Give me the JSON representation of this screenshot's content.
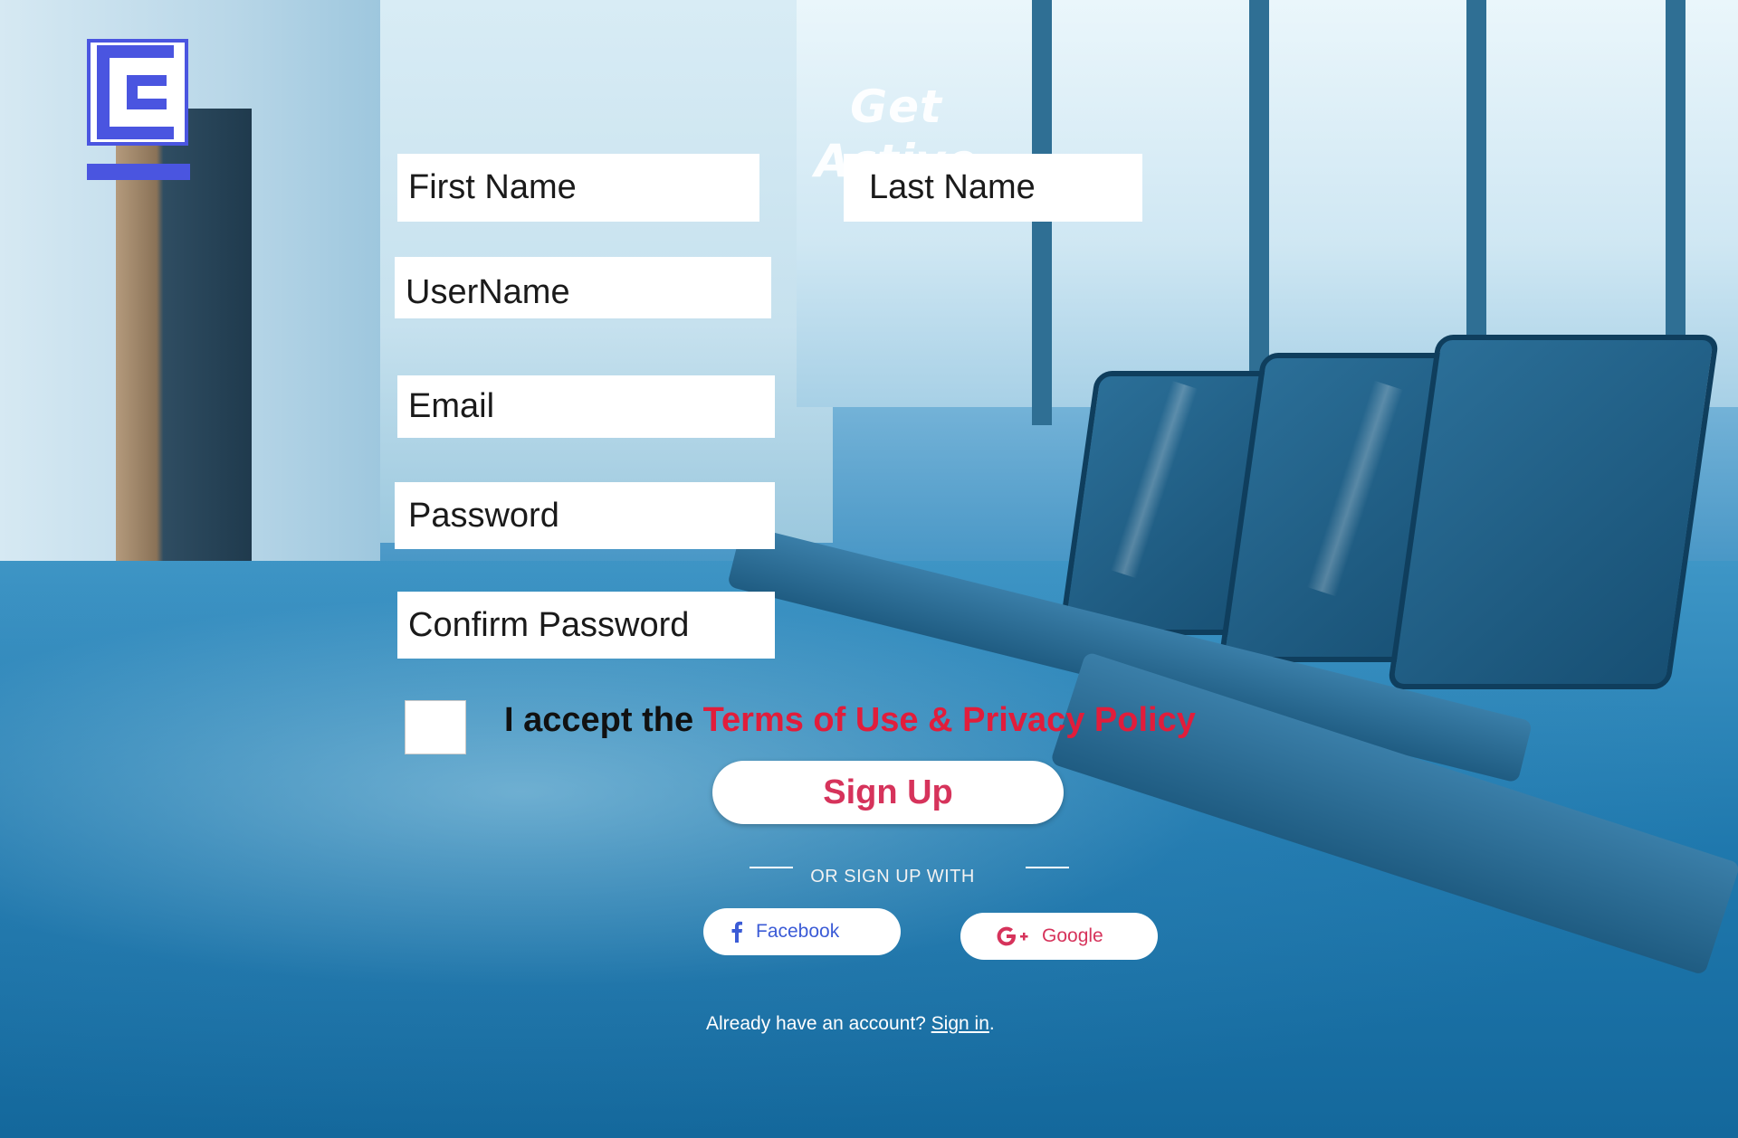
{
  "brand": {
    "logo_icon": "c-logo-icon",
    "logo_color": "#4a55e0"
  },
  "header": {
    "title": "Get Active"
  },
  "form": {
    "first_name_placeholder": "First Name",
    "last_name_placeholder": "Last Name",
    "username_placeholder": "UserName",
    "email_placeholder": "Email",
    "password_placeholder": "Password",
    "confirm_password_placeholder": "Confirm Password",
    "terms_prefix": "I accept the ",
    "terms_link": "Terms of Use & Privacy Policy",
    "signup_label": "Sign Up"
  },
  "social": {
    "divider_text": "OR SIGN UP WITH",
    "facebook_label": "Facebook",
    "facebook_icon": "facebook-icon",
    "google_label": "Google",
    "google_icon": "google-plus-icon"
  },
  "footer": {
    "signin_prompt": "Already have an account? ",
    "signin_link": "Sign in",
    "signin_suffix": "."
  },
  "colors": {
    "accent_red": "#e11d3b",
    "button_text": "#d6335b",
    "facebook_blue": "#3b5bd6"
  }
}
